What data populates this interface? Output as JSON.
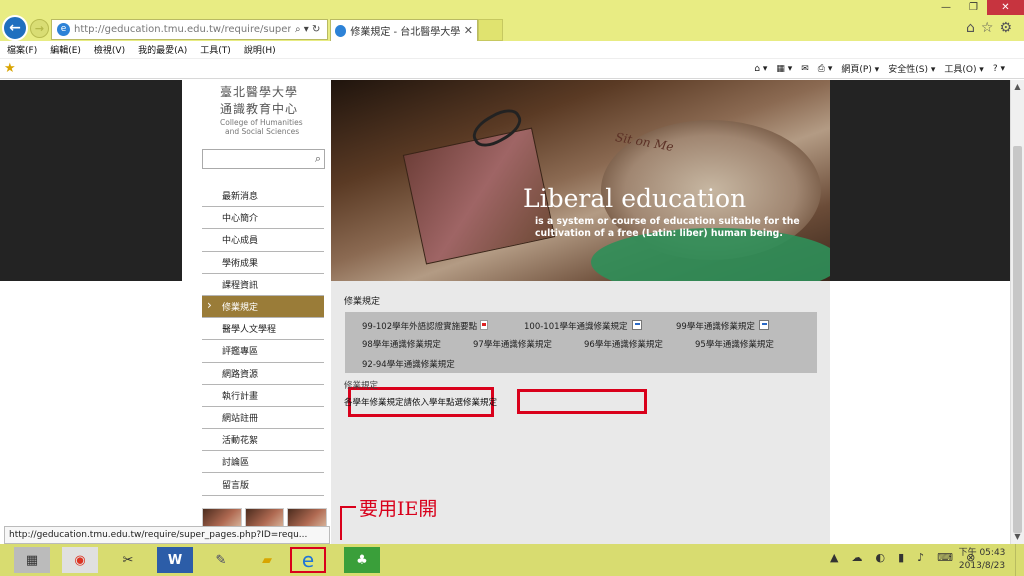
{
  "browser": {
    "address": "http://geducation.tmu.edu.tw/require/super_pages",
    "tab_title": "修業規定 - 台北醫學大學 通...",
    "menu": [
      "檔案(F)",
      "編輯(E)",
      "檢視(V)",
      "我的最愛(A)",
      "工具(T)",
      "說明(H)"
    ],
    "commands": [
      "網頁(P) ▾",
      "安全性(S) ▾",
      "工具(O) ▾"
    ]
  },
  "site": {
    "logo_cn1": "臺北醫學大學",
    "logo_cn2": "通識教育中心",
    "logo_en1": "College of Humanities",
    "logo_en2": "and Social Sciences",
    "nav": [
      "最新消息",
      "中心簡介",
      "中心成員",
      "學術成果",
      "課程資訊",
      "修業規定",
      "醫學人文學程",
      "評鑑專區",
      "網路資源",
      "執行計畫",
      "網站註冊",
      "活動花絮",
      "討論區",
      "留言版"
    ],
    "banner_script": "Sit on Me",
    "banner_title": "Liberal education",
    "banner_sub1": "is a system or course of education suitable for the",
    "banner_sub2": "cultivation of a free (Latin: liber) human being.",
    "section_title": "修業規定",
    "rules": [
      "99-102學年外語認證實施要點",
      "100-101學年通識修業規定",
      "99學年通識修業規定",
      "98學年通識修業規定",
      "97學年通識修業規定",
      "96學年通識修業規定",
      "95學年通識修業規定",
      "92-94學年通識修業規定"
    ],
    "sub_heading": "修業規定",
    "note": "各學年修業規定請依入學年點選修業規定"
  },
  "status_text": "http://geducation.tmu.edu.tw/require/super_pages.php?ID=requ...",
  "annotation": "要用IE開",
  "clock": {
    "time": "下午 05:43",
    "date": "2013/8/23"
  },
  "icons": [
    "back-arrow-icon",
    "forward-arrow-icon",
    "ie-icon",
    "search-icon",
    "refresh-icon",
    "close-icon",
    "home-icon",
    "star-icon",
    "gear-icon",
    "pdf-icon",
    "document-icon",
    "chrome-icon",
    "paint-icon",
    "word-icon",
    "folder-icon",
    "evernote-icon"
  ]
}
